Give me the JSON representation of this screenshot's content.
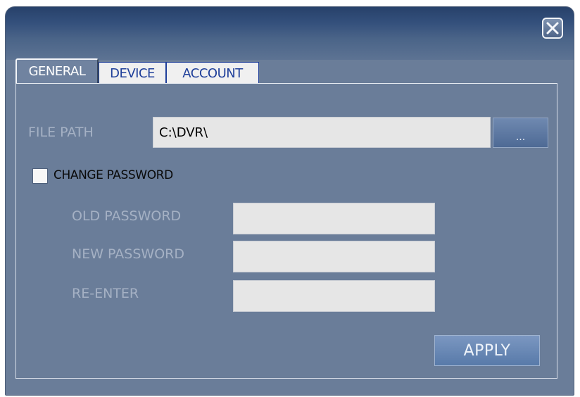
{
  "window": {
    "close_icon": "close-x-icon"
  },
  "tabs": [
    {
      "label": "GENERAL",
      "active": true
    },
    {
      "label": "DEVICE",
      "active": false
    },
    {
      "label": "ACCOUNT",
      "active": false
    }
  ],
  "general": {
    "file_path_label": "FILE PATH",
    "file_path_value": "C:\\DVR\\",
    "browse_label": "...",
    "change_password_label": "CHANGE PASSWORD",
    "change_password_checked": false,
    "old_password_label": "OLD PASSWORD",
    "new_password_label": "NEW PASSWORD",
    "reenter_label": "RE-ENTER",
    "old_password_value": "",
    "new_password_value": "",
    "reenter_value": "",
    "apply_label": "APPLY"
  },
  "colors": {
    "panel_bg": "#6a7d99",
    "title_bar": "#34507c",
    "dim_label": "#a5b1c4",
    "field_bg": "#e6e6e6",
    "tab_inactive_text": "#1f3f9a"
  }
}
